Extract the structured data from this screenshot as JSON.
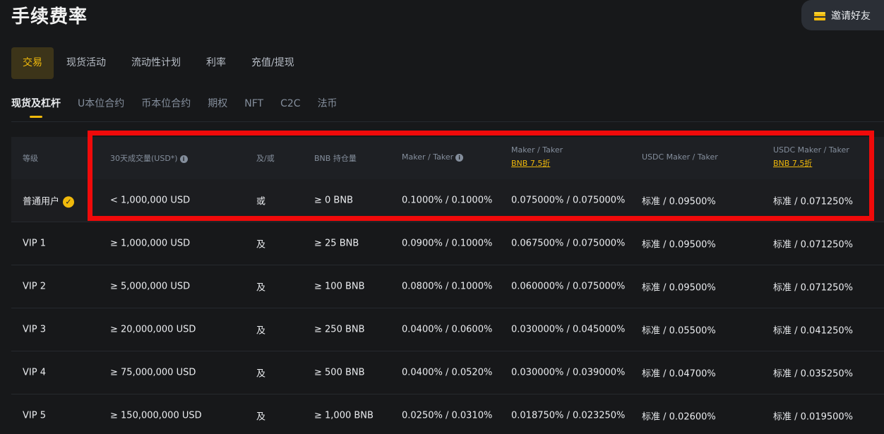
{
  "page": {
    "title": "手续费率"
  },
  "invite": {
    "icon": "gift-icon",
    "label": "邀请好友"
  },
  "main_tabs": [
    {
      "label": "交易",
      "active": true
    },
    {
      "label": "现货活动"
    },
    {
      "label": "流动性计划"
    },
    {
      "label": "利率"
    },
    {
      "label": "充值/提现"
    }
  ],
  "sub_tabs": [
    {
      "label": "现货及杠杆",
      "active": true
    },
    {
      "label": "U本位合约"
    },
    {
      "label": "币本位合约"
    },
    {
      "label": "期权"
    },
    {
      "label": "NFT"
    },
    {
      "label": "C2C"
    },
    {
      "label": "法币"
    }
  ],
  "table": {
    "headers": {
      "level": "等级",
      "volume": "30天成交量(USD*)",
      "and_or": "及/或",
      "bnb": "BNB 持仓量",
      "maker_taker": "Maker / Taker",
      "maker_taker_bnb": "Maker / Taker",
      "maker_taker_bnb_sub": "BNB 7.5折",
      "usdc_maker_taker": "USDC Maker / Taker",
      "usdc_maker_taker_bnb": "USDC Maker / Taker",
      "usdc_maker_taker_bnb_sub": "BNB 7.5折"
    },
    "rows": [
      {
        "level": "普通用户",
        "volume": "< 1,000,000 USD",
        "and_or": "或",
        "bnb": "≥ 0 BNB",
        "maker_taker": "0.1000% / 0.1000%",
        "maker_taker_bnb": "0.075000% / 0.075000%",
        "usdc": "标准 / 0.09500%",
        "usdc_bnb": "标准 / 0.071250%"
      },
      {
        "level": "VIP 1",
        "volume": "≥ 1,000,000 USD",
        "and_or": "及",
        "bnb": "≥ 25 BNB",
        "maker_taker": "0.0900% / 0.1000%",
        "maker_taker_bnb": "0.067500% / 0.075000%",
        "usdc": "标准 / 0.09500%",
        "usdc_bnb": "标准 / 0.071250%"
      },
      {
        "level": "VIP 2",
        "volume": "≥ 5,000,000 USD",
        "and_or": "及",
        "bnb": "≥ 100 BNB",
        "maker_taker": "0.0800% / 0.1000%",
        "maker_taker_bnb": "0.060000% / 0.075000%",
        "usdc": "标准 / 0.09500%",
        "usdc_bnb": "标准 / 0.071250%"
      },
      {
        "level": "VIP 3",
        "volume": "≥ 20,000,000 USD",
        "and_or": "及",
        "bnb": "≥ 250 BNB",
        "maker_taker": "0.0400% / 0.0600%",
        "maker_taker_bnb": "0.030000% / 0.045000%",
        "usdc": "标准 / 0.05500%",
        "usdc_bnb": "标准 / 0.041250%"
      },
      {
        "level": "VIP 4",
        "volume": "≥ 75,000,000 USD",
        "and_or": "及",
        "bnb": "≥ 500 BNB",
        "maker_taker": "0.0400% / 0.0520%",
        "maker_taker_bnb": "0.030000% / 0.039000%",
        "usdc": "标准 / 0.04700%",
        "usdc_bnb": "标准 / 0.035250%"
      },
      {
        "level": "VIP 5",
        "volume": "≥ 150,000,000 USD",
        "and_or": "及",
        "bnb": "≥ 1,000 BNB",
        "maker_taker": "0.0250% / 0.0310%",
        "maker_taker_bnb": "0.018750% / 0.023250%",
        "usdc": "标准 / 0.02600%",
        "usdc_bnb": "标准 / 0.019500%"
      }
    ]
  },
  "colors": {
    "accent": "#f0b90b",
    "highlight": "#f00a0a",
    "background": "#17181a"
  }
}
